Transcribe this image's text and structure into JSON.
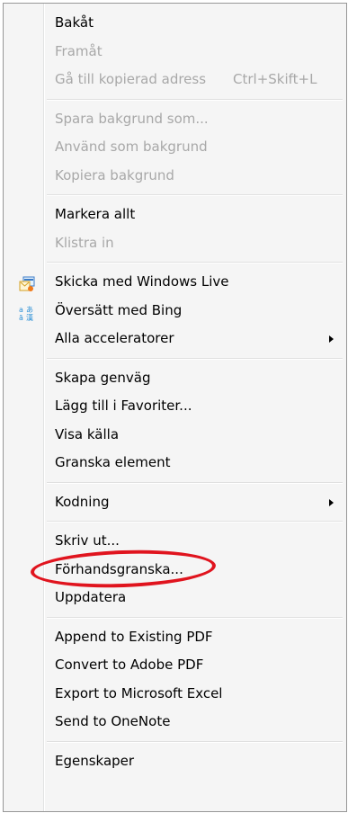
{
  "context_menu": {
    "items": [
      {
        "label": "Bakåt",
        "enabled": true
      },
      {
        "label": "Framåt",
        "enabled": false
      },
      {
        "label": "Gå till kopierad adress",
        "enabled": false,
        "shortcut": "Ctrl+Skift+L"
      },
      {
        "label": "Spara bakgrund som...",
        "enabled": false
      },
      {
        "label": "Använd som bakgrund",
        "enabled": false
      },
      {
        "label": "Kopiera bakgrund",
        "enabled": false
      },
      {
        "label": "Markera allt",
        "enabled": true
      },
      {
        "label": "Klistra in",
        "enabled": false
      },
      {
        "label": "Skicka med Windows Live",
        "enabled": true,
        "icon": "windows-live-icon"
      },
      {
        "label": "Översätt med Bing",
        "enabled": true,
        "icon": "translate-icon"
      },
      {
        "label": "Alla acceleratorer",
        "enabled": true,
        "submenu": true
      },
      {
        "label": "Skapa genväg",
        "enabled": true
      },
      {
        "label": "Lägg till i Favoriter...",
        "enabled": true
      },
      {
        "label": "Visa källa",
        "enabled": true
      },
      {
        "label": "Granska element",
        "enabled": true
      },
      {
        "label": "Kodning",
        "enabled": true,
        "submenu": true
      },
      {
        "label": "Skriv ut...",
        "enabled": true
      },
      {
        "label": "Förhandsgranska...",
        "enabled": true,
        "highlighted": true
      },
      {
        "label": "Uppdatera",
        "enabled": true
      },
      {
        "label": "Append to Existing PDF",
        "enabled": true
      },
      {
        "label": "Convert to Adobe PDF",
        "enabled": true
      },
      {
        "label": "Export to Microsoft Excel",
        "enabled": true
      },
      {
        "label": "Send to OneNote",
        "enabled": true
      },
      {
        "label": "Egenskaper",
        "enabled": true
      }
    ]
  },
  "colors": {
    "menu_background": "#f5f5f5",
    "disabled_text": "#a8a8a8",
    "annotation": "#e0141e"
  }
}
